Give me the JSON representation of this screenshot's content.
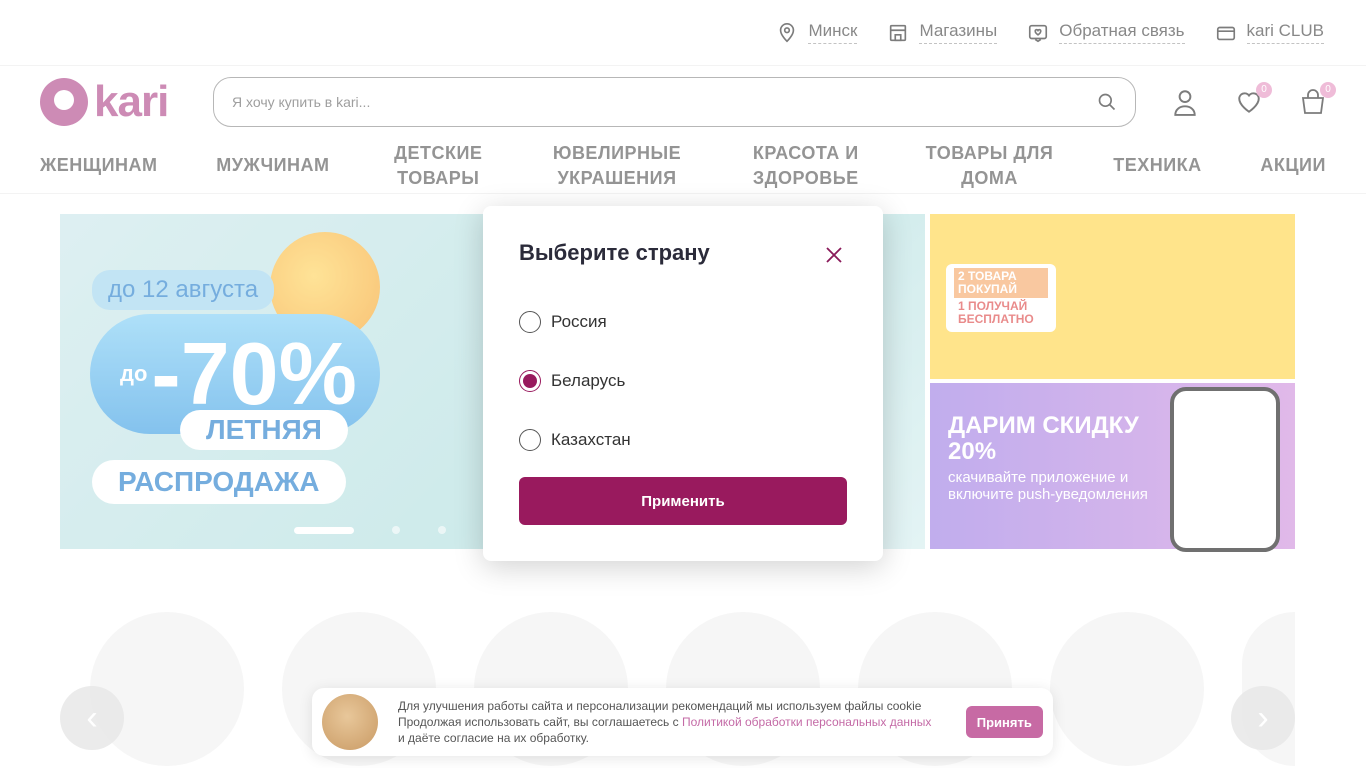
{
  "topbar": {
    "city": "Минск",
    "stores": "Магазины",
    "feedback": "Обратная связь",
    "club": "kari CLUB"
  },
  "header": {
    "logo_text": "kari",
    "search_placeholder": "Я хочу купить в kari...",
    "favorites_count": "0",
    "cart_count": "0"
  },
  "nav": {
    "items": [
      {
        "label": "ЖЕНЩИНАМ"
      },
      {
        "label": "МУЖЧИНАМ"
      },
      {
        "label": "ДЕТСКИЕ ТОВАРЫ"
      },
      {
        "label": "ЮВЕЛИРНЫЕ УКРАШЕНИЯ"
      },
      {
        "label": "КРАСОТА И ЗДОРОВЬЕ"
      },
      {
        "label": "ТОВАРЫ ДЛЯ ДОМА"
      },
      {
        "label": "ТЕХНИКА"
      },
      {
        "label": "АКЦИИ"
      }
    ]
  },
  "banner": {
    "date": "до 12 августа",
    "prefix": "до",
    "discount": "-70%",
    "line1": "ЛЕТНЯЯ",
    "line2": "РАСПРОДАЖА"
  },
  "side_promo1": {
    "row1": "2 ТОВАРА ПОКУПАЙ",
    "row2": "1 ПОЛУЧАЙ БЕСПЛАТНО"
  },
  "side_promo2": {
    "heading": "ДАРИМ СКИДКУ 20%",
    "text": "скачивайте приложение и включите push-уведомления"
  },
  "modal": {
    "title": "Выберите страну",
    "options": [
      {
        "label": "Россия",
        "selected": false
      },
      {
        "label": "Беларусь",
        "selected": true
      },
      {
        "label": "Казахстан",
        "selected": false
      }
    ],
    "apply_label": "Применить"
  },
  "cookie": {
    "text1": "Для улучшения работы сайта и персонализации рекомендаций мы используем файлы cookie",
    "text2": "Продолжая использовать сайт, вы соглашаетесь с ",
    "link": "Политикой обработки персональных данных",
    "text3": "и даёте согласие на их обработку.",
    "accept_label": "Принять"
  },
  "colors": {
    "brand": "#b85a96",
    "accent": "#991a5e",
    "cookie_button": "#c76aa4"
  }
}
